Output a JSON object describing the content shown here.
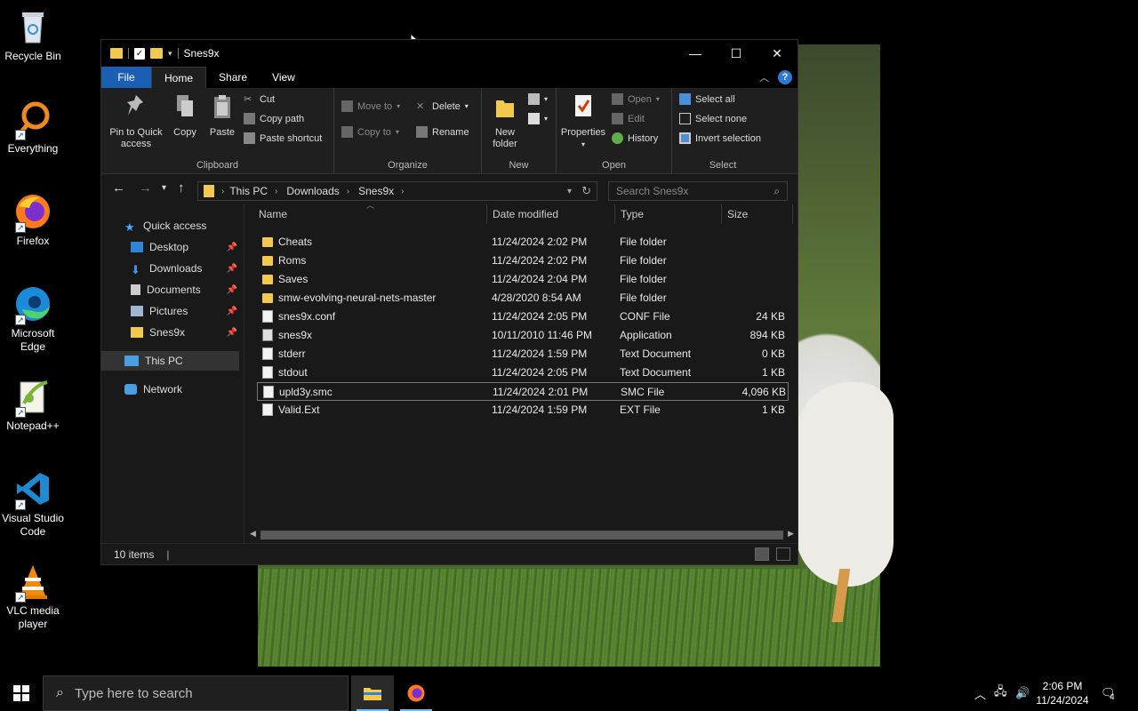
{
  "desktop": {
    "icons": [
      {
        "label": "Recycle Bin",
        "icon": "recycle-bin-icon"
      },
      {
        "label": "Everything",
        "icon": "everything-search-icon"
      },
      {
        "label": "Firefox",
        "icon": "firefox-icon"
      },
      {
        "label": "Microsoft Edge",
        "icon": "edge-icon"
      },
      {
        "label": "Notepad++",
        "icon": "notepadpp-icon"
      },
      {
        "label": "Visual Studio Code",
        "icon": "vscode-icon"
      },
      {
        "label": "VLC media player",
        "icon": "vlc-icon"
      }
    ]
  },
  "window": {
    "title": "Snes9x",
    "controls": {
      "minimize": "—",
      "maximize": "☐",
      "close": "✕"
    }
  },
  "ribbon_tabs": [
    "File",
    "Home",
    "Share",
    "View"
  ],
  "ribbon": {
    "clipboard": {
      "label": "Clipboard",
      "pin": "Pin to Quick access",
      "copy": "Copy",
      "paste": "Paste",
      "cut": "Cut",
      "copy_path": "Copy path",
      "paste_shortcut": "Paste shortcut"
    },
    "organize": {
      "label": "Organize",
      "move_to": "Move to",
      "copy_to": "Copy to",
      "delete": "Delete",
      "rename": "Rename"
    },
    "new": {
      "label": "New",
      "new_folder": "New folder"
    },
    "open": {
      "label": "Open",
      "properties": "Properties",
      "open": "Open",
      "edit": "Edit",
      "history": "History"
    },
    "select": {
      "label": "Select",
      "select_all": "Select all",
      "select_none": "Select none",
      "invert": "Invert selection"
    }
  },
  "address": {
    "crumbs": [
      "This PC",
      "Downloads",
      "Snes9x"
    ],
    "search_placeholder": "Search Snes9x"
  },
  "nav_pane": {
    "quick_access": "Quick access",
    "items": [
      "Desktop",
      "Downloads",
      "Documents",
      "Pictures",
      "Snes9x"
    ],
    "this_pc": "This PC",
    "network": "Network"
  },
  "columns": [
    "Name",
    "Date modified",
    "Type",
    "Size"
  ],
  "files": [
    {
      "name": "Cheats",
      "date": "11/24/2024 2:02 PM",
      "type": "File folder",
      "size": "",
      "kind": "folder"
    },
    {
      "name": "Roms",
      "date": "11/24/2024 2:02 PM",
      "type": "File folder",
      "size": "",
      "kind": "folder"
    },
    {
      "name": "Saves",
      "date": "11/24/2024 2:04 PM",
      "type": "File folder",
      "size": "",
      "kind": "folder"
    },
    {
      "name": "smw-evolving-neural-nets-master",
      "date": "4/28/2020 8:54 AM",
      "type": "File folder",
      "size": "",
      "kind": "folder"
    },
    {
      "name": "snes9x.conf",
      "date": "11/24/2024 2:05 PM",
      "type": "CONF File",
      "size": "24 KB",
      "kind": "doc"
    },
    {
      "name": "snes9x",
      "date": "10/11/2010 11:46 PM",
      "type": "Application",
      "size": "894 KB",
      "kind": "app"
    },
    {
      "name": "stderr",
      "date": "11/24/2024 1:59 PM",
      "type": "Text Document",
      "size": "0 KB",
      "kind": "doc"
    },
    {
      "name": "stdout",
      "date": "11/24/2024 2:05 PM",
      "type": "Text Document",
      "size": "1 KB",
      "kind": "doc"
    },
    {
      "name": "upld3y.smc",
      "date": "11/24/2024 2:01 PM",
      "type": "SMC File",
      "size": "4,096 KB",
      "kind": "doc"
    },
    {
      "name": "Valid.Ext",
      "date": "11/24/2024 1:59 PM",
      "type": "EXT File",
      "size": "1 KB",
      "kind": "doc"
    }
  ],
  "status": {
    "items": "10 items"
  },
  "taskbar": {
    "search_placeholder": "Type here to search",
    "time": "2:06 PM",
    "date": "11/24/2024",
    "notifications": "4"
  },
  "colors": {
    "file_tab": "#1a5fb4",
    "folder": "#f2c94c",
    "accent": "#76b9ed"
  }
}
